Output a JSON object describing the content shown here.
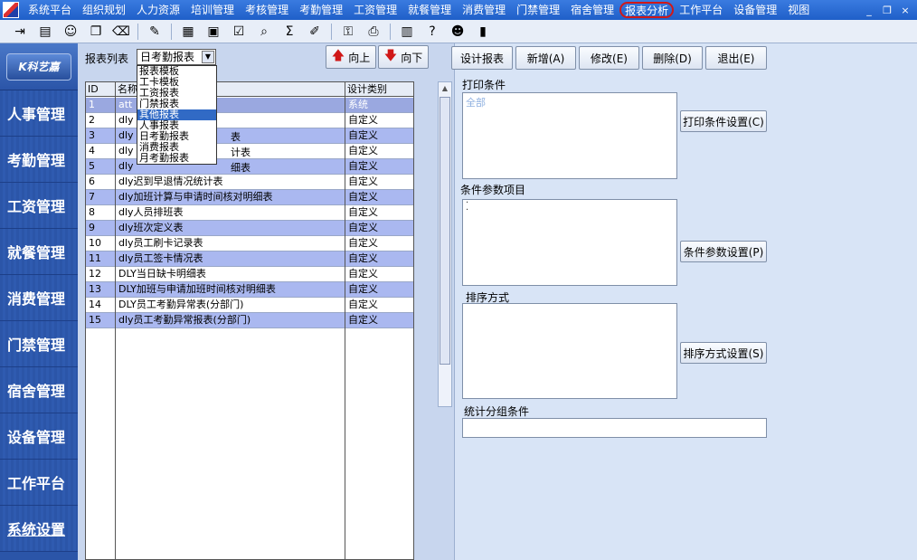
{
  "menubar": {
    "items": [
      "系统平台",
      "组织规划",
      "人力资源",
      "培训管理",
      "考核管理",
      "考勤管理",
      "工资管理",
      "就餐管理",
      "消费管理",
      "门禁管理",
      "宿舍管理",
      "报表分析",
      "工作平台",
      "设备管理",
      "视图"
    ],
    "circled_index": 11,
    "window_controls": [
      "_",
      "❐",
      "×"
    ]
  },
  "toolbar": {
    "icons": [
      "exit-icon",
      "document-icon",
      "user-icon",
      "copy-icon",
      "eraser-icon",
      "edit-icon",
      "calculator-icon",
      "calendar-icon",
      "checklist-icon",
      "search-icon",
      "sum-icon",
      "pen-icon",
      "key-icon",
      "print-icon",
      "columns-icon",
      "help-icon",
      "users-icon",
      "door-icon"
    ],
    "glyphs": [
      "⇥",
      "▤",
      "☺",
      "❐",
      "⌫",
      "✎",
      "▦",
      "▣",
      "☑",
      "⌕",
      "Σ",
      "✐",
      "⚿",
      "⎙",
      "▥",
      "?",
      "☻",
      "▮"
    ]
  },
  "sidebar": {
    "brand": "K科艺嘉",
    "items": [
      "人事管理",
      "考勤管理",
      "工资管理",
      "就餐管理",
      "消费管理",
      "门禁管理",
      "宿舍管理",
      "设备管理",
      "工作平台",
      "系统设置"
    ]
  },
  "left": {
    "report_list_label": "报表列表",
    "select_value": "日考勤报表",
    "up_button": "向上",
    "down_button": "向下",
    "columns": [
      "ID",
      "名称",
      "设计类别"
    ],
    "rows": [
      {
        "id": "1",
        "name": "att",
        "type": "系统"
      },
      {
        "id": "2",
        "name": "dly",
        "type": "自定义"
      },
      {
        "id": "3",
        "name": "dly",
        "type": "自定义"
      },
      {
        "id": "4",
        "name": "dly",
        "type": "自定义"
      },
      {
        "id": "5",
        "name": "dly",
        "type": "自定义"
      },
      {
        "id": "6",
        "name": "dly迟到早退情况统计表",
        "type": "自定义"
      },
      {
        "id": "7",
        "name": "dly加班计算与申请时间核对明细表",
        "type": "自定义"
      },
      {
        "id": "8",
        "name": "dly人员排班表",
        "type": "自定义"
      },
      {
        "id": "9",
        "name": "dly班次定义表",
        "type": "自定义"
      },
      {
        "id": "10",
        "name": "dly员工刷卡记录表",
        "type": "自定义"
      },
      {
        "id": "11",
        "name": "dly员工签卡情况表",
        "type": "自定义"
      },
      {
        "id": "12",
        "name": "DLY当日缺卡明细表",
        "type": "自定义"
      },
      {
        "id": "13",
        "name": "DLY加班与申请加班时间核对明细表",
        "type": "自定义"
      },
      {
        "id": "14",
        "name": "DLY员工考勤异常表(分部门)",
        "type": "自定义"
      },
      {
        "id": "15",
        "name": "dly员工考勤异常报表(分部门)",
        "type": "自定义"
      }
    ],
    "partial_texts": [
      "表",
      "计表",
      "细表"
    ],
    "dropdown_options": [
      "报表模板",
      "工卡模板",
      "工资报表",
      "门禁报表",
      "其他报表",
      "人事报表",
      "日考勤报表",
      "消费报表",
      "月考勤报表"
    ],
    "dropdown_highlight": 4
  },
  "right": {
    "buttons": [
      "设计报表",
      "新增(A)",
      "修改(E)",
      "删除(D)",
      "退出(E)"
    ],
    "print_condition_label": "打印条件",
    "print_condition_value": "全部",
    "print_condition_btn": "打印条件设置(C)",
    "param_label": "条件参数项目",
    "param_btn": "条件参数设置(P)",
    "sort_label": "排序方式",
    "sort_btn": "排序方式设置(S)",
    "group_label": "统计分组条件"
  }
}
